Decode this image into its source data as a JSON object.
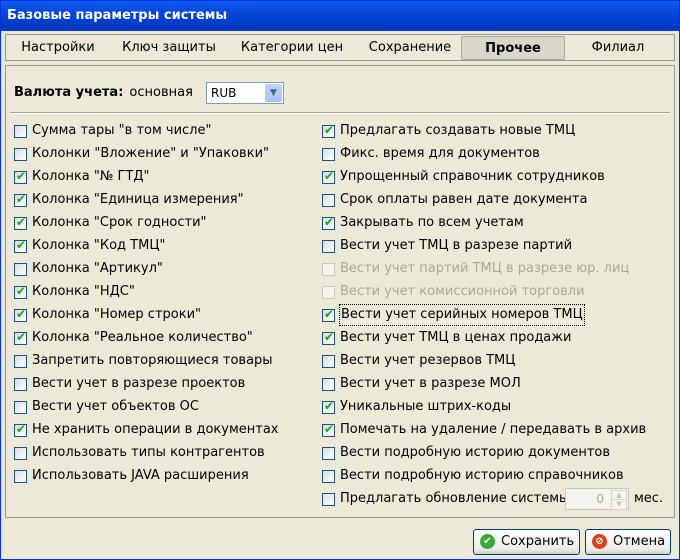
{
  "window": {
    "title": "Базовые параметры системы"
  },
  "tabs": [
    {
      "label": "Настройки"
    },
    {
      "label": "Ключ защиты"
    },
    {
      "label": "Категории цен"
    },
    {
      "label": "Сохранение"
    },
    {
      "label": "Прочее",
      "active": true
    },
    {
      "label": "Филиал"
    }
  ],
  "currency": {
    "label": "Валюта учета:",
    "sublabel": "основная",
    "value": "RUB"
  },
  "left_items": [
    {
      "label": "Сумма тары \"в том числе\"",
      "checked": false
    },
    {
      "label": "Колонки \"Вложение\" и \"Упаковки\"",
      "checked": false
    },
    {
      "label": "Колонка \"№ ГТД\"",
      "checked": true
    },
    {
      "label": "Колонка \"Единица измерения\"",
      "checked": true
    },
    {
      "label": "Колонка \"Срок годности\"",
      "checked": true
    },
    {
      "label": "Колонка \"Код ТМЦ\"",
      "checked": true
    },
    {
      "label": "Колонка \"Артикул\"",
      "checked": false
    },
    {
      "label": "Колонка \"НДС\"",
      "checked": true
    },
    {
      "label": "Колонка \"Номер строки\"",
      "checked": true
    },
    {
      "label": "Колонка \"Реальное количество\"",
      "checked": true
    },
    {
      "label": "Запретить повторяющиеся товары",
      "checked": false
    },
    {
      "label": "Вести учет в разрезе  проектов",
      "checked": false
    },
    {
      "label": "Вести учет объектов ОС",
      "checked": false
    },
    {
      "label": "Не хранить операции в документах",
      "checked": true
    },
    {
      "label": "Использовать типы контрагентов",
      "checked": false
    },
    {
      "label": "Использовать JAVA расширения",
      "checked": false
    }
  ],
  "right_items": [
    {
      "label": "Предлагать создавать новые ТМЦ",
      "checked": true
    },
    {
      "label": "Фикс. время для документов",
      "checked": false
    },
    {
      "label": "Упрощенный справочник сотрудников",
      "checked": true
    },
    {
      "label": "Срок оплаты равен дате документа",
      "checked": false
    },
    {
      "label": "Закрывать по всем учетам",
      "checked": true
    },
    {
      "label": "Вести учет ТМЦ в разрезе партий",
      "checked": false
    },
    {
      "label": "Вести учет партий ТМЦ в разрезе юр. лиц",
      "checked": false,
      "disabled": true
    },
    {
      "label": "Вести учет комиссионной торговли",
      "checked": false,
      "disabled": true
    },
    {
      "label": "Вести учет серийных номеров ТМЦ",
      "checked": true,
      "focused": true
    },
    {
      "label": "Вести учет ТМЦ в ценах продажи",
      "checked": true
    },
    {
      "label": "Вести учет резервов ТМЦ",
      "checked": false
    },
    {
      "label": "Вести учет в разрезе МОЛ",
      "checked": false
    },
    {
      "label": "Уникальные штрих-коды",
      "checked": true
    },
    {
      "label": "Помечать на удаление / передавать в архив",
      "checked": true
    },
    {
      "label": "Вести подробную историю документов",
      "checked": false
    },
    {
      "label": "Вести подробную историю справочников",
      "checked": false
    },
    {
      "label": "Предлагать обновление системы",
      "checked": false
    }
  ],
  "update_months": {
    "value": "0",
    "unit": "мес."
  },
  "buttons": {
    "save": "Сохранить",
    "cancel": "Отмена"
  },
  "colors": {
    "title_bar": "#0846d8",
    "check": "#21a121",
    "face": "#ece9d8"
  }
}
